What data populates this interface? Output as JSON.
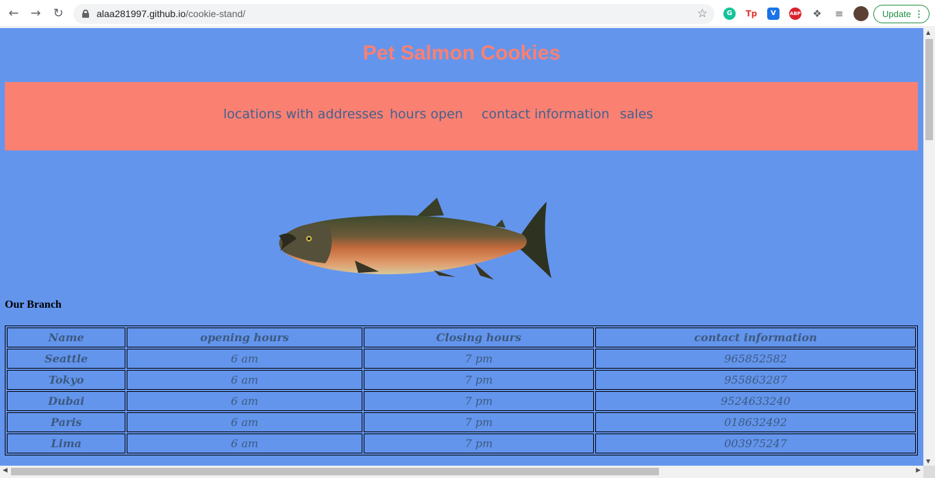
{
  "browser": {
    "url_host": "alaa281997.github.io",
    "url_path": "/cookie-stand/",
    "update_label": "Update",
    "extensions": [
      {
        "name": "grammarly-icon",
        "text": "G",
        "color": "#15c39a"
      },
      {
        "name": "tp-icon",
        "text": "Tp",
        "color": "#e53935"
      },
      {
        "name": "shield-vpn-icon",
        "text": "V",
        "color": "#1a73e8"
      },
      {
        "name": "adblock-plus-icon",
        "text": "ABP",
        "color": "#d9232e"
      }
    ]
  },
  "page": {
    "title": "Pet Salmon Cookies",
    "nav": [
      {
        "label": "locations with addresses"
      },
      {
        "label": "hours open"
      },
      {
        "label": "contact information"
      },
      {
        "label": "sales"
      }
    ],
    "branch_heading": "Our Branch",
    "table": {
      "headers": [
        "Name",
        "opening hours",
        "Closing hours",
        "contact information"
      ],
      "rows": [
        [
          "Seattle",
          "6 am",
          "7 pm",
          "965852582"
        ],
        [
          "Tokyo",
          "6 am",
          "7 pm",
          "955863287"
        ],
        [
          "Dubai",
          "6 am",
          "7 pm",
          "9524633240"
        ],
        [
          "Paris",
          "6 am",
          "7 pm",
          "018632492"
        ],
        [
          "Lima",
          "6 am",
          "7 pm",
          "003975247"
        ]
      ]
    }
  },
  "colors": {
    "background": "#6495ed",
    "accent": "#fa8072",
    "text": "#41628f"
  }
}
